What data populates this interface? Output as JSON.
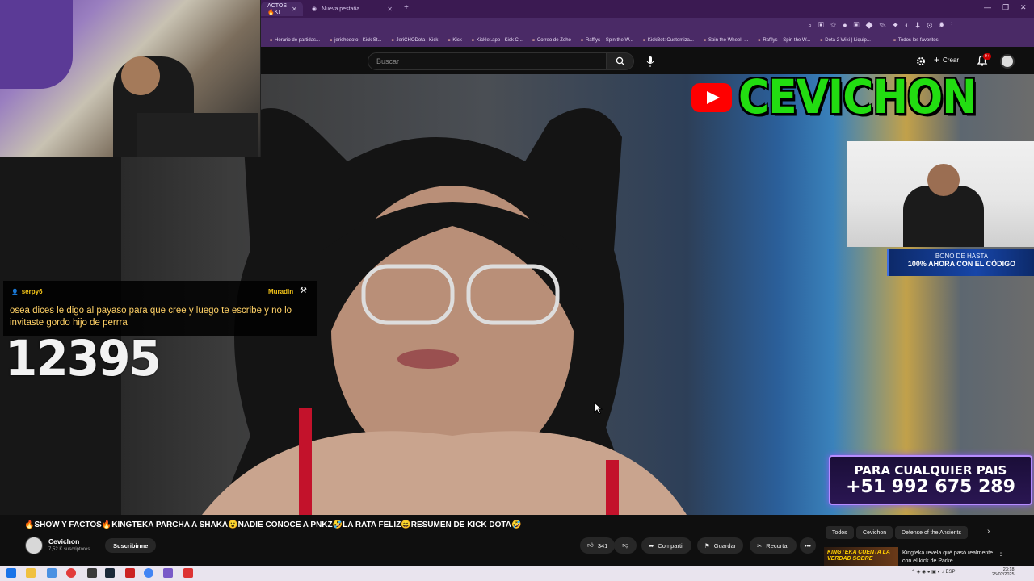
{
  "browser": {
    "tabs": [
      {
        "label": "ACTOS 🔥KI",
        "active": true
      },
      {
        "label": "Nueva pestaña",
        "active": false
      }
    ],
    "bookmarks": [
      "Horario de partidas...",
      "jerichodoto - Kick St...",
      "JeriCHODota | Kick",
      "Kick",
      "Kicklet.app - Kick C...",
      "Correo de Zoho",
      "Rafflys – Spin the W...",
      "KickBot: Customiza...",
      "Spin the Wheel -...",
      "Rafflys – Spin the W...",
      "Dota 2 Wiki | Liquip...",
      "Todos los favoritos"
    ]
  },
  "youtube_header": {
    "search_placeholder": "Buscar",
    "create_label": "Crear",
    "notification_count": "9+"
  },
  "overlays": {
    "channel_logo_text": "CEVICHON",
    "bono_line1": "BONO DE HASTA",
    "bono_line2": "100% AHORA CON EL CÓDIGO",
    "phone_line1": "PARA CUALQUIER PAIS",
    "phone_line2": "+51 992 675 289",
    "counter": "12395"
  },
  "chat": {
    "username": "serpy6",
    "game": "Muradin",
    "message": "osea dices le digo al payaso para que cree y luego te escribe y no lo invitaste gordo hijo de perrra"
  },
  "video_info": {
    "title": "🔥SHOW Y FACTOS🔥KINGTEKA PARCHA A SHAKA😮NADIE CONOCE A PNKZ🤣LA RATA FELIZ😄RESUMEN DE KICK DOTA🤣",
    "channel_name": "Cevichon",
    "subscribers": "7,52 K suscriptores",
    "subscribe_label": "Suscribirme",
    "likes": "341",
    "share_label": "Compartir",
    "save_label": "Guardar",
    "clip_label": "Recortar"
  },
  "recommendations": {
    "chips": [
      "Todos",
      "Cevichon",
      "Defense of the Ancients"
    ],
    "thumb_text": "KINGTEKA CUENTA LA VERDAD SOBRE",
    "video_title": "Kingteka revela qué pasó realmente con el kick de Parke..."
  },
  "taskbar": {
    "time": "23:18",
    "date": "25/02/2025",
    "lang": "ESP"
  },
  "colors": {
    "accent_purple": "#3b1a52",
    "logo_green": "#22dd11",
    "chat_yellow": "#f5c518",
    "yt_red": "#ff0000"
  }
}
